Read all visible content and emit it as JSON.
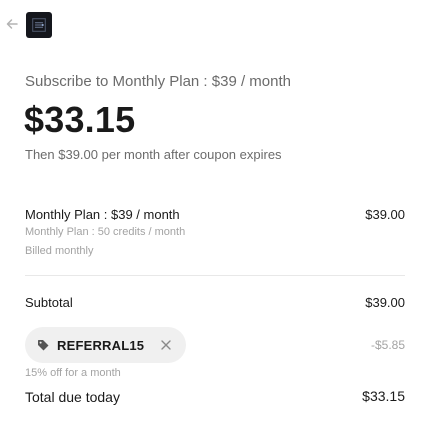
{
  "header": {
    "back_icon": "arrow-left-icon",
    "logo_icon": "app-logo-icon"
  },
  "summary": {
    "plan_title": "Subscribe to Monthly Plan : $39 / month",
    "price": "$33.15",
    "then_text": "Then $39.00 per month after coupon expires"
  },
  "line_item": {
    "name": "Monthly Plan : $39 / month",
    "amount": "$39.00",
    "description": "Monthly Plan : 50 credits / month",
    "billing": "Billed monthly"
  },
  "subtotal": {
    "label": "Subtotal",
    "amount": "$39.00"
  },
  "coupon": {
    "code": "REFERRAL15",
    "discount": "-$5.85",
    "description": "15% off for a month",
    "tag_icon": "tag-icon",
    "remove_icon": "close-icon"
  },
  "total": {
    "label": "Total due today",
    "amount": "$33.15"
  },
  "colors": {
    "primary_text": "#1a1a1a",
    "secondary_text": "#6b6b6b",
    "muted_text": "#a3a3a3",
    "pill_background": "#f0f0f0",
    "logo_background": "#14161c"
  }
}
